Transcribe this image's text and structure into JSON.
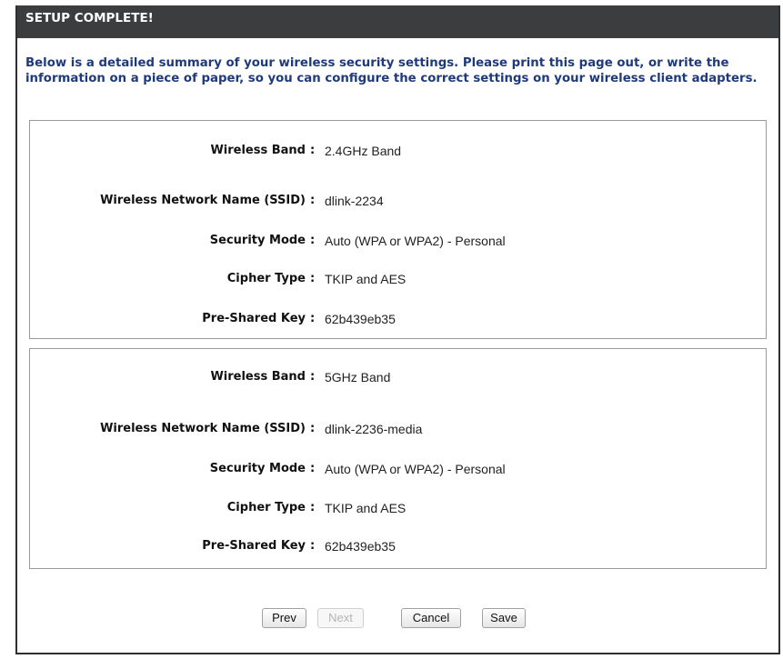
{
  "header": {
    "title": "SETUP COMPLETE!"
  },
  "intro": {
    "text": "Below is a detailed summary of your wireless security settings. Please print this page out, or write the information on a piece of paper, so you can configure the correct settings on your wireless client adapters."
  },
  "bands": [
    {
      "rows": [
        {
          "label": "Wireless Band",
          "value": "2.4GHz Band"
        },
        {
          "label": "Wireless Network Name (SSID)",
          "value": "dlink-2234"
        },
        {
          "label": "Security Mode",
          "value": "Auto (WPA or WPA2) - Personal"
        },
        {
          "label": "Cipher Type",
          "value": "TKIP and AES"
        },
        {
          "label": "Pre-Shared Key",
          "value": "62b439eb35"
        }
      ]
    },
    {
      "rows": [
        {
          "label": "Wireless Band",
          "value": "5GHz Band"
        },
        {
          "label": "Wireless Network Name (SSID)",
          "value": "dlink-2236-media"
        },
        {
          "label": "Security Mode",
          "value": "Auto (WPA or WPA2) - Personal"
        },
        {
          "label": "Cipher Type",
          "value": "TKIP and AES"
        },
        {
          "label": "Pre-Shared Key",
          "value": "62b439eb35"
        }
      ]
    }
  ],
  "separator": ":",
  "buttons": {
    "prev": "Prev",
    "next": "Next",
    "cancel": "Cancel",
    "save": "Save"
  },
  "colors": {
    "title_bar": "#3c3d3f",
    "intro_text": "#1f3a7a"
  }
}
